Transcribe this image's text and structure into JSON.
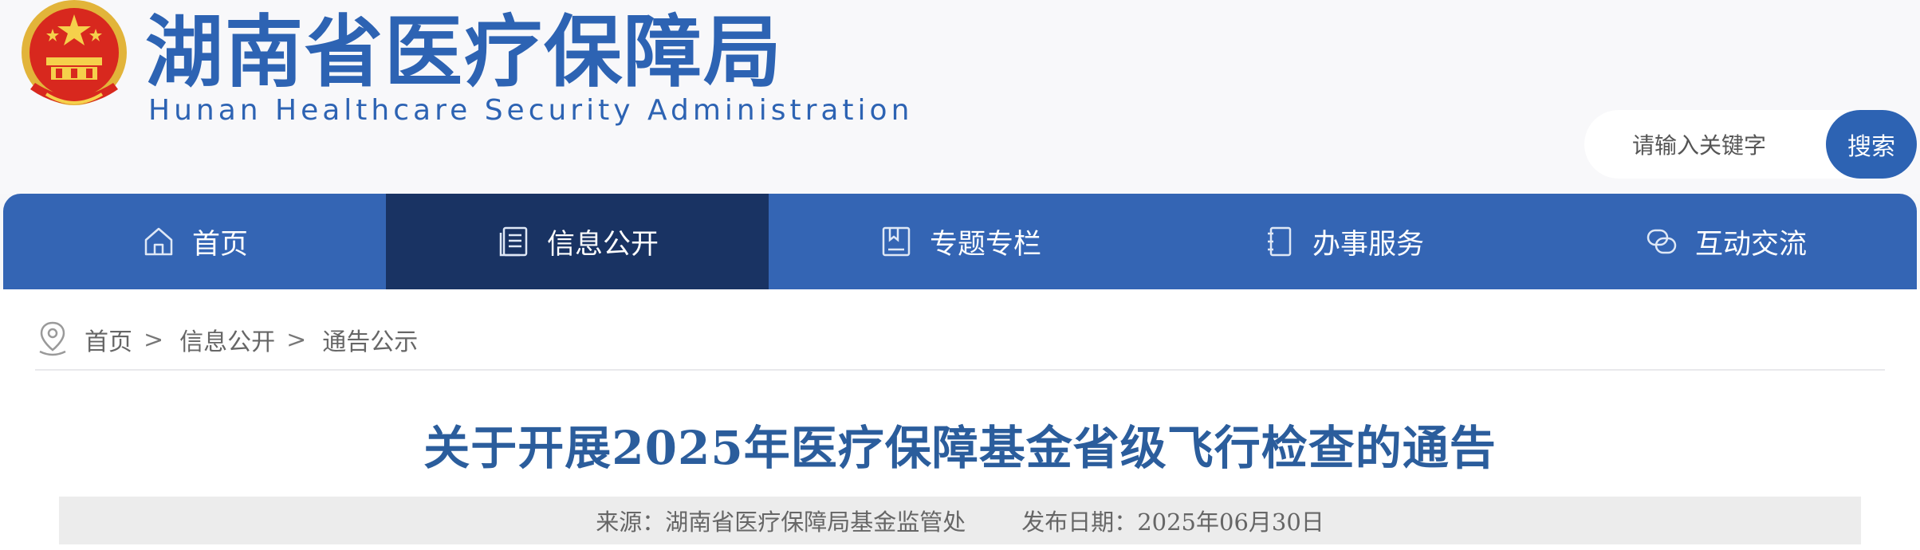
{
  "header": {
    "title_cn": "湖南省医疗保障局",
    "title_en": "Hunan Healthcare Security Administration",
    "search": {
      "placeholder": "请输入关键字",
      "button_label": "搜索"
    }
  },
  "nav": {
    "items": [
      {
        "label": "首页",
        "icon": "home-icon"
      },
      {
        "label": "信息公开",
        "icon": "document-list-icon",
        "active": true
      },
      {
        "label": "专题专栏",
        "icon": "bookmark-book-icon"
      },
      {
        "label": "办事服务",
        "icon": "notebook-icon"
      },
      {
        "label": "互动交流",
        "icon": "chat-bubbles-icon"
      }
    ],
    "colors": {
      "bar": "#3465b4",
      "active": "#193363"
    }
  },
  "breadcrumb": {
    "icon": "location-pin-icon",
    "items": [
      "首页",
      "信息公开",
      "通告公示"
    ],
    "separator": ">"
  },
  "article": {
    "title": "关于开展2025年医疗保障基金省级飞行检查的通告",
    "source": "来源：湖南省医疗保障局基金监管处",
    "date": "发布日期：2025年06月30日"
  },
  "colors": {
    "brand": "#2d63b3",
    "title": "#2b5d9c"
  }
}
